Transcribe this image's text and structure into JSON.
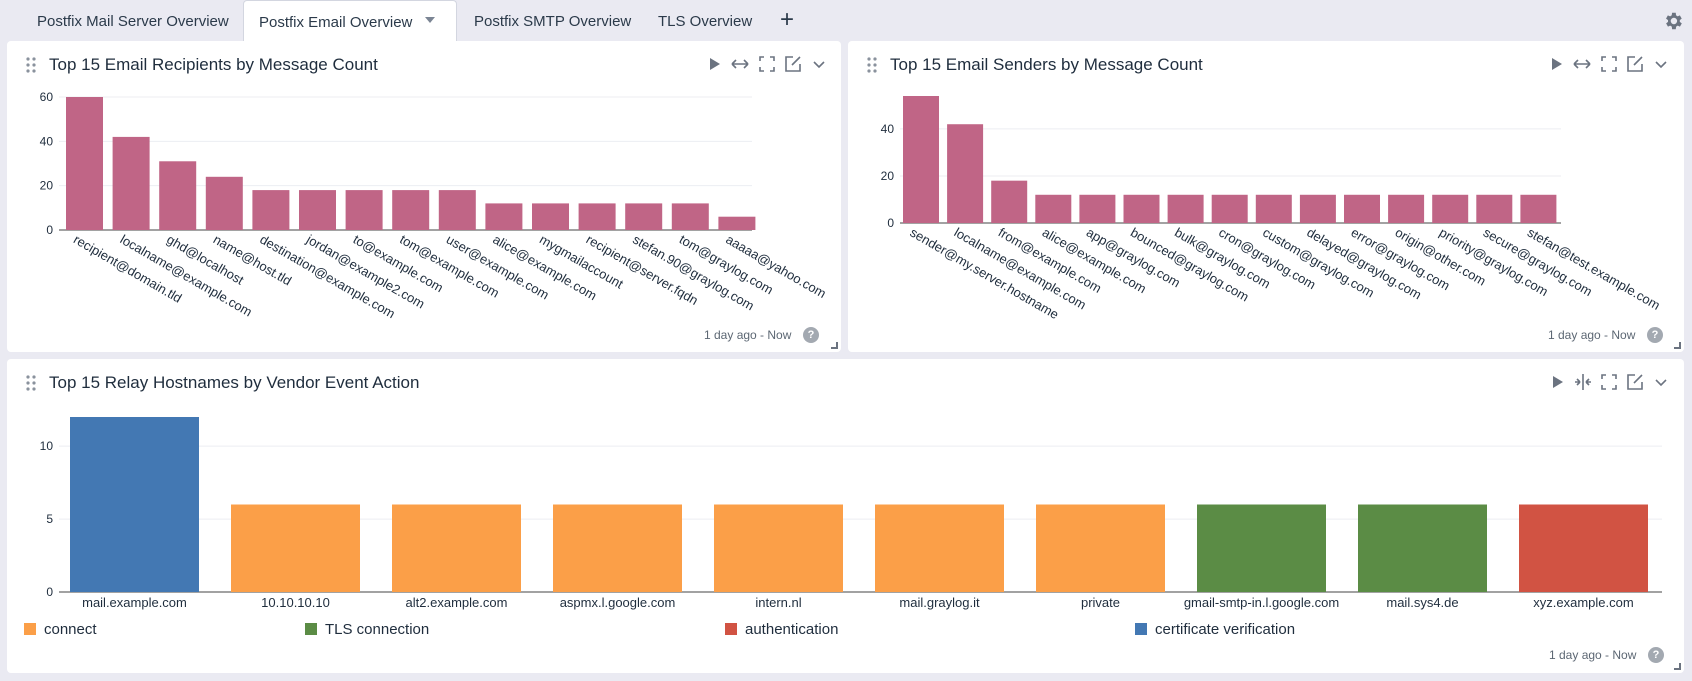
{
  "tabs": [
    {
      "label": "Postfix Mail Server Overview"
    },
    {
      "label": "Postfix Email Overview"
    },
    {
      "label": "Postfix SMTP Overview"
    },
    {
      "label": "TLS Overview"
    }
  ],
  "add_tab_label": "+",
  "colors": {
    "bar_pink": "#c06586",
    "connect": "#fb9f48",
    "tls": "#5b8c45",
    "authentication": "#d15343",
    "certificate": "#4378b3"
  },
  "panels": [
    {
      "title": "Top 15 Email Recipients by Message Count",
      "time": "1 day ago - Now",
      "help": "?"
    },
    {
      "title": "Top 15 Email Senders by Message Count",
      "time": "1 day ago - Now",
      "help": "?"
    },
    {
      "title": "Top 15 Relay Hostnames by Vendor Event Action",
      "time": "1 day ago - Now",
      "help": ""
    }
  ],
  "legend": [
    {
      "label": "connect",
      "color": "#fb9f48"
    },
    {
      "label": "TLS connection",
      "color": "#5b8c45"
    },
    {
      "label": "authentication",
      "color": "#d15343"
    },
    {
      "label": "certificate verification",
      "color": "#4378b3"
    }
  ],
  "chart_data": [
    {
      "type": "bar",
      "categories": [
        "recipient@domain.tld",
        "localname@example.com",
        "ghd@localhost",
        "name@host.tld",
        "destination@example.com",
        "jordan@example2.com",
        "to@example.com",
        "tom@example.com",
        "user@example.com",
        "alice@example.com",
        "mygmailaccount",
        "recipient@server.fqdn",
        "stefan.90@graylog.com",
        "tom@graylog.com",
        "aaaaa@yahoo.com"
      ],
      "values": [
        60,
        42,
        31,
        24,
        18,
        18,
        18,
        18,
        18,
        12,
        12,
        12,
        12,
        12,
        6
      ],
      "ylim": [
        0,
        60
      ],
      "yticks": [
        0,
        20,
        40,
        60
      ],
      "color": "#c06586"
    },
    {
      "type": "bar",
      "categories": [
        "sender@my.server.hostname",
        "localname@example.com",
        "from@example.com",
        "alice@example.com",
        "app@graylog.com",
        "bounced@graylog.com",
        "bulk@graylog.com",
        "cron@graylog.com",
        "custom@graylog.com",
        "delayed@graylog.com",
        "error@graylog.com",
        "origin@other.com",
        "priority@graylog.com",
        "secure@graylog.com",
        "stefan@test.example.com"
      ],
      "values": [
        54,
        42,
        18,
        12,
        12,
        12,
        12,
        12,
        12,
        12,
        12,
        12,
        12,
        12,
        12
      ],
      "ylim": [
        0,
        54
      ],
      "yticks": [
        0,
        20,
        40
      ],
      "color": "#c06586"
    },
    {
      "type": "bar",
      "categories": [
        "mail.example.com",
        "10.10.10.10",
        "alt2.example.com",
        "aspmx.l.google.com",
        "intern.nl",
        "mail.graylog.it",
        "private",
        "gmail-smtp-in.l.google.com",
        "mail.sys4.de",
        "xyz.example.com"
      ],
      "values": [
        12,
        6,
        6,
        6,
        6,
        6,
        6,
        6,
        6,
        6
      ],
      "series_of_bar": [
        "certificate verification",
        "connect",
        "connect",
        "connect",
        "connect",
        "connect",
        "connect",
        "TLS connection",
        "TLS connection",
        "authentication"
      ],
      "ylim": [
        0,
        12
      ],
      "yticks": [
        0,
        5,
        10
      ]
    }
  ]
}
